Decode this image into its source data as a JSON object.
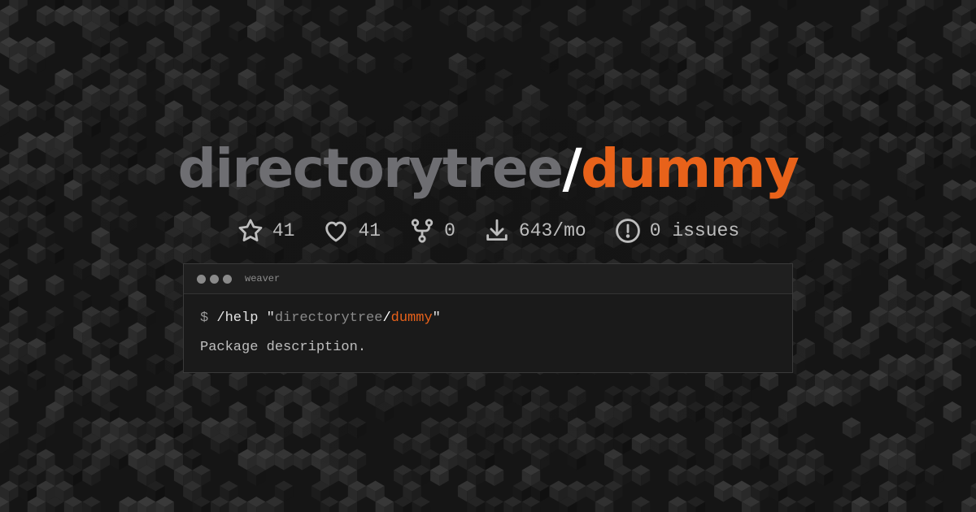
{
  "title": {
    "vendor": "directorytree",
    "slash": "/",
    "package": "dummy"
  },
  "stats": {
    "stars": "41",
    "favorites": "41",
    "forks": "0",
    "downloads": "643/mo",
    "issues": "0 issues"
  },
  "terminal": {
    "window_name": "weaver",
    "prompt": "$",
    "command": "/help",
    "quote_open": "\"",
    "arg_vendor": "directorytree",
    "arg_slash": "/",
    "arg_package": "dummy",
    "quote_close": "\"",
    "output": "Package description."
  },
  "colors": {
    "background": "#151515",
    "accent": "#e8621a",
    "vendor_gray": "#6e6e72",
    "icon_gray": "#bdbdbd"
  },
  "icons": {
    "stars": "star-icon",
    "favorites": "heart-icon",
    "forks": "fork-icon",
    "downloads": "download-icon",
    "issues": "issue-icon"
  }
}
